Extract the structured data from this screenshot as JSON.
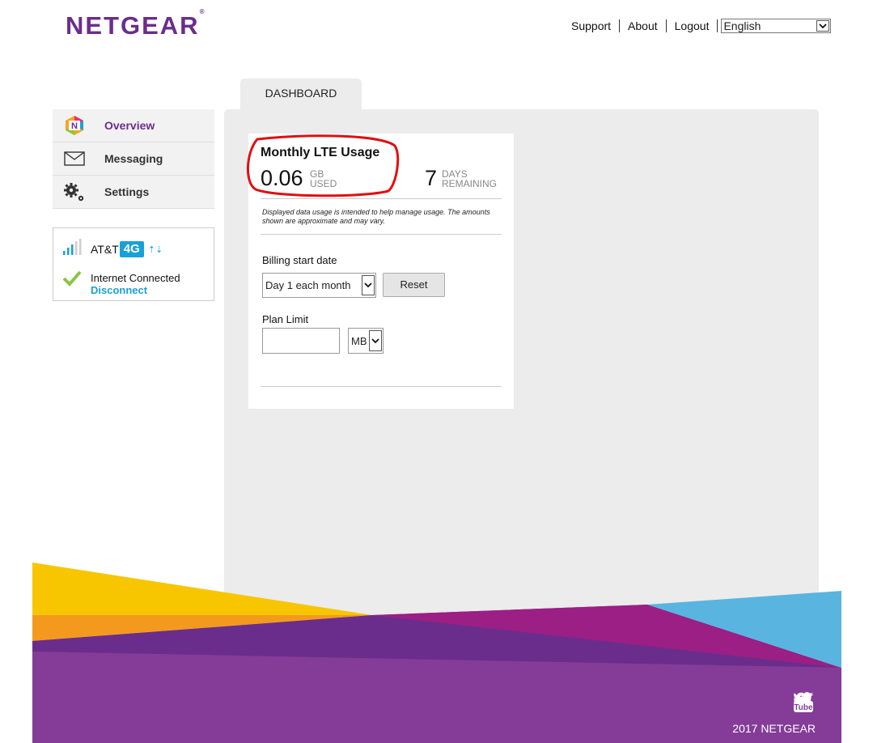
{
  "header": {
    "logo": "NETGEAR",
    "links": [
      "Support",
      "About",
      "Logout"
    ],
    "language": "English"
  },
  "tab": {
    "label": "DASHBOARD"
  },
  "sidebar": {
    "items": [
      {
        "label": "Overview",
        "icon": "netgear-n-icon",
        "active": true
      },
      {
        "label": "Messaging",
        "icon": "envelope-icon"
      },
      {
        "label": "Settings",
        "icon": "gears-icon"
      }
    ]
  },
  "status": {
    "carrier": "AT&T",
    "network": "4G",
    "connection": "Internet Connected",
    "disconnect": "Disconnect"
  },
  "usage": {
    "title": "Monthly LTE Usage",
    "used_value": "0.06",
    "used_unit_line1": "GB",
    "used_unit_line2": "USED",
    "days_value": "7",
    "days_unit_line1": "DAYS",
    "days_unit_line2": "REMAINING",
    "disclaimer": "Displayed data usage is intended to help manage usage. The amounts shown are approximate and may vary.",
    "billing_label": "Billing start date",
    "billing_value": "Day 1 each month",
    "reset_label": "Reset",
    "plan_label": "Plan Limit",
    "plan_value": "",
    "plan_unit": "MB"
  },
  "footer": {
    "copyright": "2017 NETGEAR",
    "social": [
      "twitter-icon",
      "facebook-icon",
      "youtube-icon"
    ],
    "youtube_text": "You Tube"
  },
  "colors": {
    "brand_purple": "#6b2d8c",
    "accent_blue": "#1aa0d8",
    "annotation_red": "#e01010"
  }
}
